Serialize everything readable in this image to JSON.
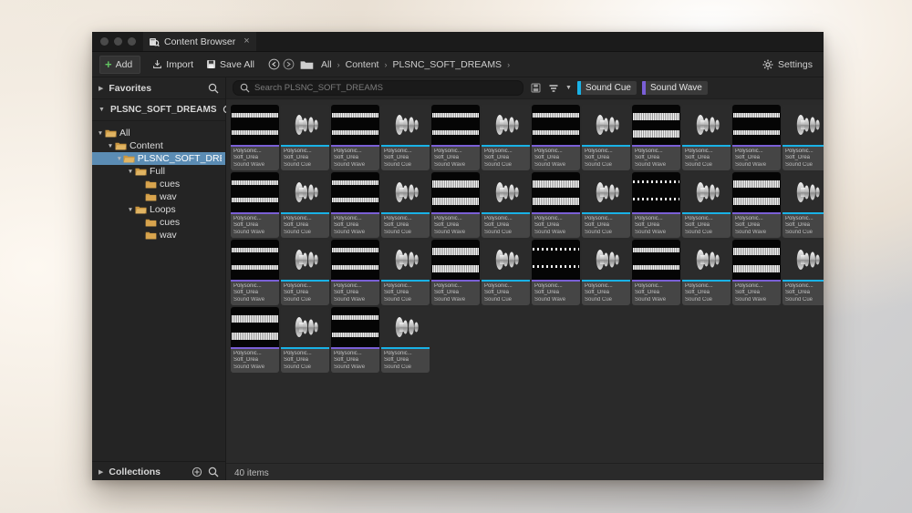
{
  "window": {
    "tab_title": "Content Browser",
    "tab_icon": "content-browser-icon",
    "close_label": "×"
  },
  "toolbar": {
    "add_label": "Add",
    "import_label": "Import",
    "save_all_label": "Save All",
    "back_icon": "back-arrow-icon",
    "forward_icon": "forward-arrow-icon",
    "folder_icon": "folder-icon",
    "settings_label": "Settings",
    "settings_icon": "gear-icon",
    "breadcrumbs": [
      {
        "label": "All"
      },
      {
        "label": "Content"
      },
      {
        "label": "PLSNC_SOFT_DREAMS"
      }
    ],
    "separator": "›"
  },
  "sidebar": {
    "favorites_label": "Favorites",
    "project_label": "PLSNC_SOFT_DREAMS",
    "collections_label": "Collections",
    "search_icon": "search-icon",
    "add_collection_icon": "add-circle-icon",
    "tree": [
      {
        "label": "All",
        "depth": 0,
        "expanded": true,
        "selected": false,
        "open_folder": true
      },
      {
        "label": "Content",
        "depth": 1,
        "expanded": true,
        "selected": false,
        "open_folder": true
      },
      {
        "label": "PLSNC_SOFT_DREAMS",
        "depth": 2,
        "expanded": true,
        "selected": true,
        "open_folder": true
      },
      {
        "label": "Full",
        "depth": 3,
        "expanded": true,
        "selected": false,
        "open_folder": true
      },
      {
        "label": "cues",
        "depth": 4,
        "expanded": false,
        "selected": false,
        "open_folder": false
      },
      {
        "label": "wav",
        "depth": 4,
        "expanded": false,
        "selected": false,
        "open_folder": false
      },
      {
        "label": "Loops",
        "depth": 3,
        "expanded": true,
        "selected": false,
        "open_folder": true
      },
      {
        "label": "cues",
        "depth": 4,
        "expanded": false,
        "selected": false,
        "open_folder": false
      },
      {
        "label": "wav",
        "depth": 4,
        "expanded": false,
        "selected": false,
        "open_folder": false
      }
    ]
  },
  "search": {
    "placeholder": "Search PLSNC_SOFT_DREAMS",
    "search_icon": "search-icon",
    "save_search_icon": "save-icon",
    "filter_icon": "filter-icon",
    "chevron_icon": "chevron-down-icon"
  },
  "filters": [
    {
      "label": "Sound Cue",
      "color": "#19b2e6"
    },
    {
      "label": "Sound Wave",
      "color": "#7a5fd6"
    }
  ],
  "colors": {
    "sound_cue": "#19b2e6",
    "sound_wave": "#7a5fd6",
    "selection": "#5b8cb4",
    "accent_green": "#62c462",
    "tab_accent": "#3a7fb5"
  },
  "status": {
    "item_count_label": "40 items"
  },
  "assets": {
    "name_line1": "Polysonic...",
    "name_line2": "Soft_Drea",
    "type_sound_wave": "Sound Wave",
    "type_sound_cue": "Sound Cue",
    "total": 40,
    "items": [
      {
        "type": "wave",
        "wf": "flat"
      },
      {
        "type": "cue"
      },
      {
        "type": "wave",
        "wf": "flat"
      },
      {
        "type": "cue"
      },
      {
        "type": "wave",
        "wf": "flat"
      },
      {
        "type": "cue"
      },
      {
        "type": "wave",
        "wf": "flat"
      },
      {
        "type": "cue"
      },
      {
        "type": "wave",
        "wf": "tall"
      },
      {
        "type": "cue"
      },
      {
        "type": "wave",
        "wf": "flat"
      },
      {
        "type": "cue"
      },
      {
        "type": "wave",
        "wf": "flat"
      },
      {
        "type": "cue"
      },
      {
        "type": "wave",
        "wf": "flat"
      },
      {
        "type": "cue"
      },
      {
        "type": "wave",
        "wf": "tall"
      },
      {
        "type": "cue"
      },
      {
        "type": "wave",
        "wf": "tall"
      },
      {
        "type": "cue"
      },
      {
        "type": "wave",
        "wf": "dots"
      },
      {
        "type": "cue"
      },
      {
        "type": "wave",
        "wf": "tall"
      },
      {
        "type": "cue"
      },
      {
        "type": "wave",
        "wf": "flat"
      },
      {
        "type": "cue"
      },
      {
        "type": "wave",
        "wf": "flat"
      },
      {
        "type": "cue"
      },
      {
        "type": "wave",
        "wf": "tall"
      },
      {
        "type": "cue"
      },
      {
        "type": "wave",
        "wf": "dots"
      },
      {
        "type": "cue"
      },
      {
        "type": "wave",
        "wf": "flat"
      },
      {
        "type": "cue"
      },
      {
        "type": "wave",
        "wf": "tall"
      },
      {
        "type": "cue"
      },
      {
        "type": "wave",
        "wf": "tall"
      },
      {
        "type": "cue"
      },
      {
        "type": "wave",
        "wf": "flat"
      },
      {
        "type": "cue"
      }
    ]
  }
}
